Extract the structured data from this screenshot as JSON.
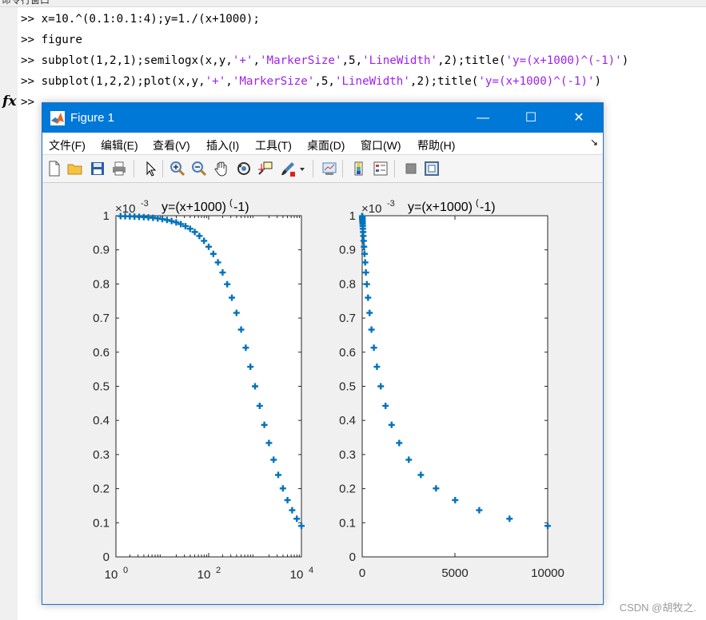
{
  "command_window": {
    "header_text": "命令行窗口",
    "prompt": ">>",
    "lines": [
      {
        "code_before": "x=10.^(0.1:0.1:4);y=1./(x+1000);"
      },
      {
        "code_before": "figure"
      },
      {
        "code_before": "subplot(1,2,1);semilogx(x,y,",
        "s1": "'+'",
        "c1": ",",
        "s2": "'MarkerSize'",
        "c2": ",5,",
        "s3": "'LineWidth'",
        "c3": ",2);title(",
        "s4": "'y=(x+1000)^(-1)'",
        "c4": ")"
      },
      {
        "code_before": "subplot(1,2,2);plot(x,y,",
        "s1": "'+'",
        "c1": ",",
        "s2": "'MarkerSize'",
        "c2": ",5,",
        "s3": "'LineWidth'",
        "c3": ",2);title(",
        "s4": "'y=(x+1000)^(-1)'",
        "c4": ")"
      }
    ],
    "fx_label": "fx",
    "current_prompt": ">>"
  },
  "figure": {
    "title": "Figure 1",
    "controls": {
      "minimize": "—",
      "maximize": "☐",
      "close": "✕"
    },
    "menu": [
      "文件(F)",
      "编辑(E)",
      "查看(V)",
      "插入(I)",
      "工具(T)",
      "桌面(D)",
      "窗口(W)",
      "帮助(H)"
    ],
    "menu_dock_arrow": "↘",
    "toolbar_icons": [
      "new-figure-icon",
      "open-file-icon",
      "save-icon",
      "print-icon",
      "select-arrow-icon",
      "zoom-in-icon",
      "zoom-out-icon",
      "pan-hand-icon",
      "rotate-3d-icon",
      "data-cursor-icon",
      "brush-icon",
      "link-plot-icon",
      "colorbar-icon",
      "legend-icon",
      "hide-tools-icon",
      "show-tools-icon"
    ]
  },
  "chart_data": [
    {
      "type": "scatter",
      "title": "y=(x+1000)^(-1)",
      "title_main": "y=(x+1000)",
      "title_sup": "(",
      "title_tail": "-1)",
      "x_scale": "log",
      "xlim": [
        1,
        10000
      ],
      "ylim": [
        0,
        0.001
      ],
      "exponent_label_base": "×10",
      "exponent_label_power": "-3",
      "x_ticks": [
        {
          "base": "10",
          "exp": "0"
        },
        {
          "base": "10",
          "exp": "2"
        },
        {
          "base": "10",
          "exp": "4"
        }
      ],
      "y_ticks": [
        "0",
        "0.1",
        "0.2",
        "0.3",
        "0.4",
        "0.5",
        "0.6",
        "0.7",
        "0.8",
        "0.9",
        "1"
      ],
      "marker": "+",
      "color": "#0072bd",
      "formula": "x=10.^(0.1:0.1:4); y=1./(x+1000)"
    },
    {
      "type": "scatter",
      "title": "y=(x+1000)^(-1)",
      "title_main": "y=(x+1000)",
      "title_sup": "(",
      "title_tail": "-1)",
      "x_scale": "linear",
      "xlim": [
        0,
        10000
      ],
      "ylim": [
        0,
        0.001
      ],
      "exponent_label_base": "×10",
      "exponent_label_power": "-3",
      "x_ticks": [
        "0",
        "5000",
        "10000"
      ],
      "y_ticks": [
        "0",
        "0.1",
        "0.2",
        "0.3",
        "0.4",
        "0.5",
        "0.6",
        "0.7",
        "0.8",
        "0.9",
        "1"
      ],
      "marker": "+",
      "color": "#0072bd",
      "formula": "x=10.^(0.1:0.1:4); y=1./(x+1000)"
    }
  ],
  "watermark": "CSDN @胡牧之."
}
